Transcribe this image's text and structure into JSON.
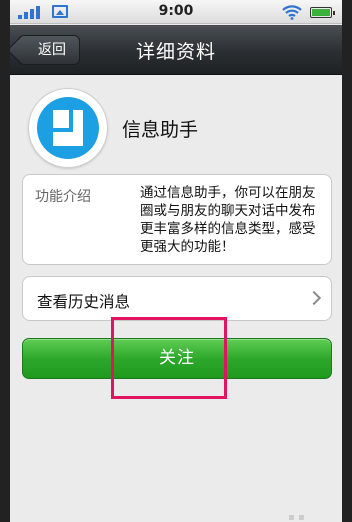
{
  "status_bar": {
    "time": "9:00",
    "icons": [
      "signal-icon",
      "image-icon",
      "wifi-icon",
      "battery-icon"
    ],
    "battery_level": 1.0
  },
  "header": {
    "back_label": "返回",
    "title": "详细资料"
  },
  "profile": {
    "name": "信息助手",
    "avatar_icon": "document-icon"
  },
  "intro": {
    "label": "功能介绍",
    "text": "通过信息助手，你可以在朋友圈或与朋友的聊天对话中发布更丰富多样的信息类型，感受更强大的功能！"
  },
  "history": {
    "label": "查看历史消息"
  },
  "actions": {
    "follow_label": "关注"
  },
  "colors": {
    "accent_green": "#2ea82b",
    "highlight": "#e0155f",
    "avatar_blue": "#1d9fe3"
  }
}
